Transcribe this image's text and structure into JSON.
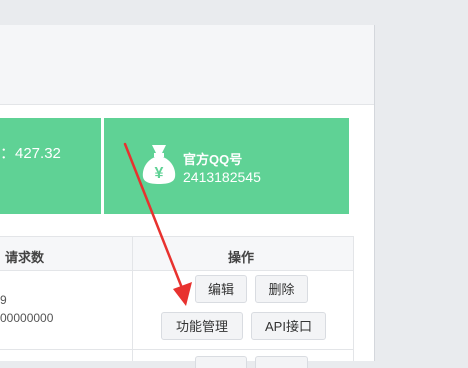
{
  "stats": {
    "balance_fragment": "：427.32",
    "qq_label": "官方QQ号",
    "qq_number": "2413182545"
  },
  "table": {
    "headers": {
      "requests": "请求数",
      "actions": "操作"
    },
    "row1": {
      "line1": "9",
      "line2": "00000000"
    }
  },
  "buttons": {
    "edit": "编辑",
    "delete": "删除",
    "function_manage": "功能管理",
    "api_interface": "API接口"
  },
  "colors": {
    "card_green": "#5fd295",
    "arrow_red": "#e8322f"
  },
  "icons": {
    "money_bag": "money-bag-icon",
    "annotation_arrow": "red-arrow-icon"
  }
}
